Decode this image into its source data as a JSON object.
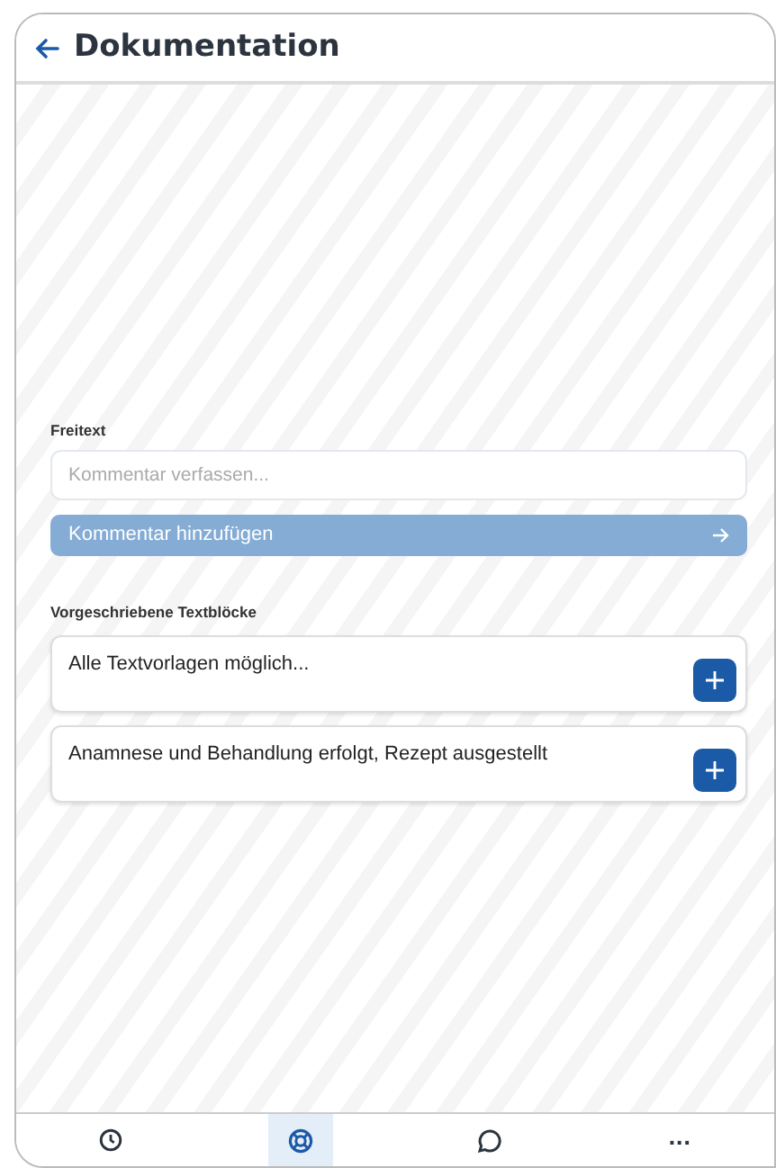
{
  "header": {
    "title": "Dokumentation"
  },
  "freitext": {
    "label": "Freitext",
    "placeholder": "Kommentar verfassen...",
    "button": "Kommentar hinzufügen",
    "button_disabled": true
  },
  "textblocks": {
    "label": "Vorgeschriebene Textblöcke",
    "items": [
      {
        "text": "Alle Textvorlagen möglich..."
      },
      {
        "text": "Anamnese und Behandlung erfolgt, Rezept ausgestellt"
      }
    ]
  },
  "bottom_nav": [
    {
      "kind": "clock",
      "selected": false
    },
    {
      "kind": "lifebuoy",
      "selected": true
    },
    {
      "kind": "chat",
      "selected": false
    },
    {
      "kind": "more",
      "text": "...",
      "selected": false
    }
  ]
}
